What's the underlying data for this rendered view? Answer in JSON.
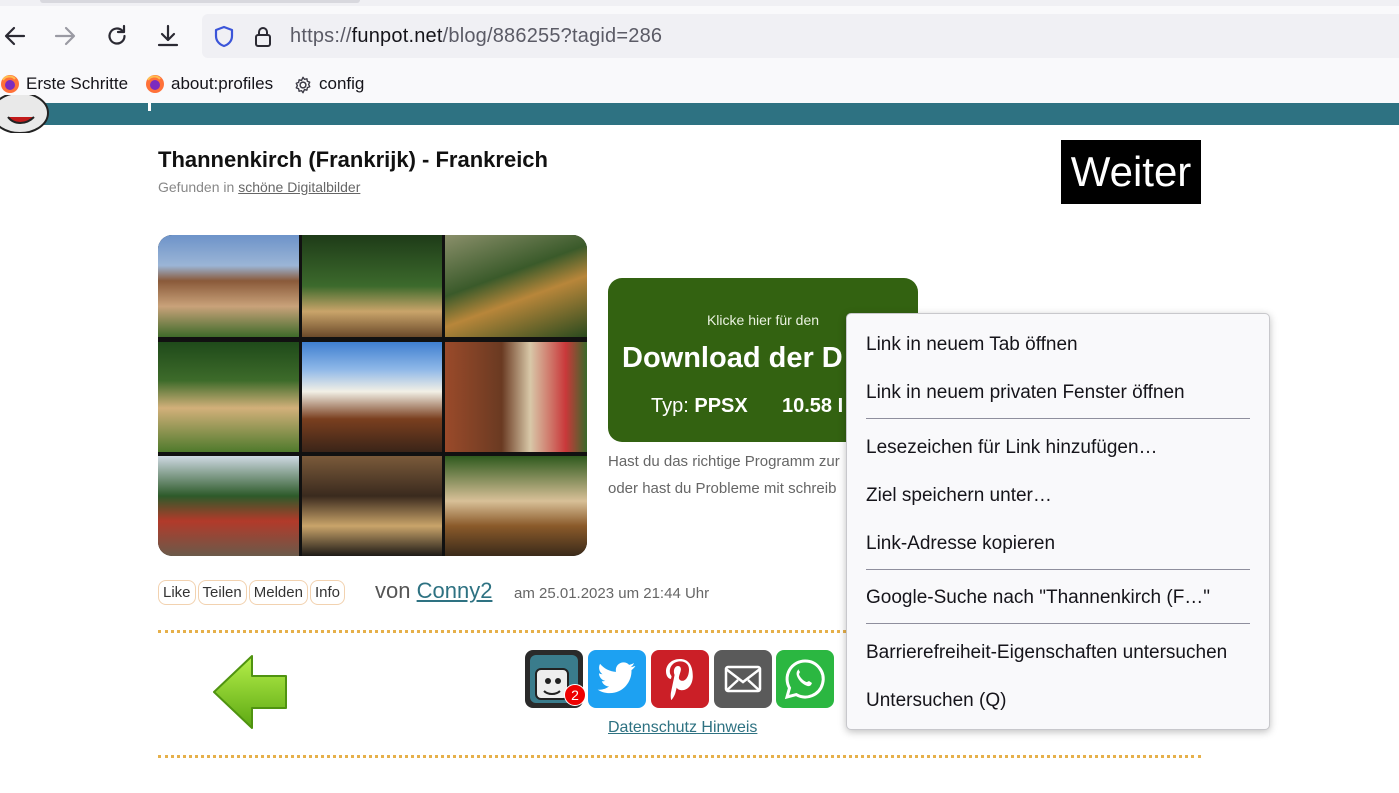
{
  "browser": {
    "url_scheme": "https://",
    "url_host": "funpot.net",
    "url_path": "/blog/886255?tagid=286",
    "bookmarks": [
      {
        "label": "Erste Schritte",
        "icon": "firefox-icon"
      },
      {
        "label": "about:profiles",
        "icon": "firefox-icon"
      },
      {
        "label": "config",
        "icon": "gear-icon"
      }
    ],
    "toolbar_icons": [
      "back-arrow-icon",
      "forward-arrow-icon",
      "reload-icon",
      "download-icon",
      "shield-icon",
      "lock-icon"
    ]
  },
  "post": {
    "title": "Thannenkirch (Frankrijk) - Frankreich",
    "found_prefix": "Gefunden in",
    "found_link": "schöne Digitalbilder",
    "next_button": "Weiter",
    "download": {
      "intro": "Klicke hier für den",
      "headline": "Download der D",
      "type_label": "Typ:",
      "type_value": "PPSX",
      "size": "10.58 I"
    },
    "help_line1": "Hast du das richtige Programm zur",
    "help_line2": "oder hast du Probleme mit schreib",
    "actions": [
      "Like",
      "Teilen",
      "Melden",
      "Info"
    ],
    "author_prefix": "von",
    "author": "Conny2",
    "date": "am 25.01.2023 um 21:44 Uhr",
    "share_badge": "2",
    "privacy_link": "Datenschutz Hinweis"
  },
  "context_menu": {
    "items": [
      "Link in neuem Tab öffnen",
      "Link in neuem privaten Fenster öffnen",
      "Lesezeichen für Link hinzufügen…",
      "Ziel speichern unter…",
      "Link-Adresse kopieren",
      "Google-Suche nach \"Thannenkirch (F…\"",
      "Barrierefreiheit-Eigenschaften untersuchen",
      "Untersuchen (Q)"
    ]
  },
  "colors": {
    "header_teal": "#2e7282",
    "download_green": "#336211",
    "dotted_line": "#e6b04a",
    "link_teal": "#2e7282"
  }
}
